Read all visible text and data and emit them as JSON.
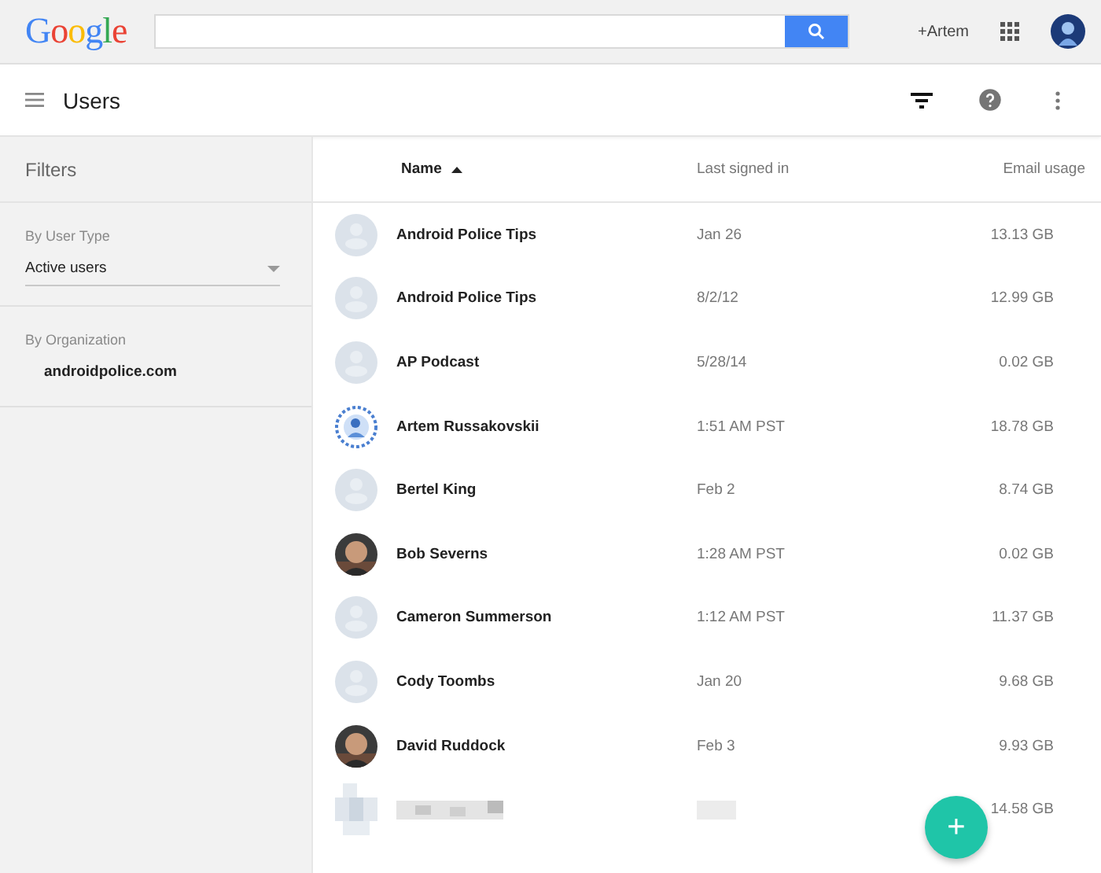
{
  "topbar": {
    "logo": "Google",
    "user": "+Artem"
  },
  "toolbar": {
    "title": "Users"
  },
  "sidebar": {
    "title": "Filters",
    "sections": [
      {
        "label": "By User Type",
        "kind": "select",
        "value": "Active users"
      },
      {
        "label": "By Organization",
        "kind": "item",
        "value": "androidpolice.com"
      }
    ]
  },
  "table": {
    "columns": [
      {
        "label": "Name",
        "sorted": true
      },
      {
        "label": "Last signed in",
        "sorted": false
      },
      {
        "label": "Email usage",
        "sorted": false
      }
    ],
    "rows": [
      {
        "kind": "placeholder",
        "name": "Android Police Tips",
        "last": "Jan 26",
        "usage": "13.13 GB"
      },
      {
        "kind": "placeholder",
        "name": "Android Police Tips",
        "last": "8/2/12",
        "usage": "12.99 GB"
      },
      {
        "kind": "placeholder",
        "name": "AP Podcast",
        "last": "5/28/14",
        "usage": "0.02 GB"
      },
      {
        "kind": "spiky",
        "name": "Artem Russakovskii",
        "last": "1:51 AM PST",
        "usage": "18.78 GB"
      },
      {
        "kind": "placeholder",
        "name": "Bertel King",
        "last": "Feb 2",
        "usage": "8.74 GB"
      },
      {
        "kind": "picture",
        "name": "Bob Severns",
        "last": "1:28 AM PST",
        "usage": "0.02 GB"
      },
      {
        "kind": "placeholder",
        "name": "Cameron Summerson",
        "last": "1:12 AM PST",
        "usage": "11.37 GB"
      },
      {
        "kind": "placeholder",
        "name": "Cody Toombs",
        "last": "Jan 20",
        "usage": "9.68 GB"
      },
      {
        "kind": "picture",
        "name": "David Ruddock",
        "last": "Feb 3",
        "usage": "9.93 GB"
      },
      {
        "kind": "blurred",
        "usage": "14.58 GB"
      }
    ]
  },
  "fab": {
    "label": "+"
  }
}
